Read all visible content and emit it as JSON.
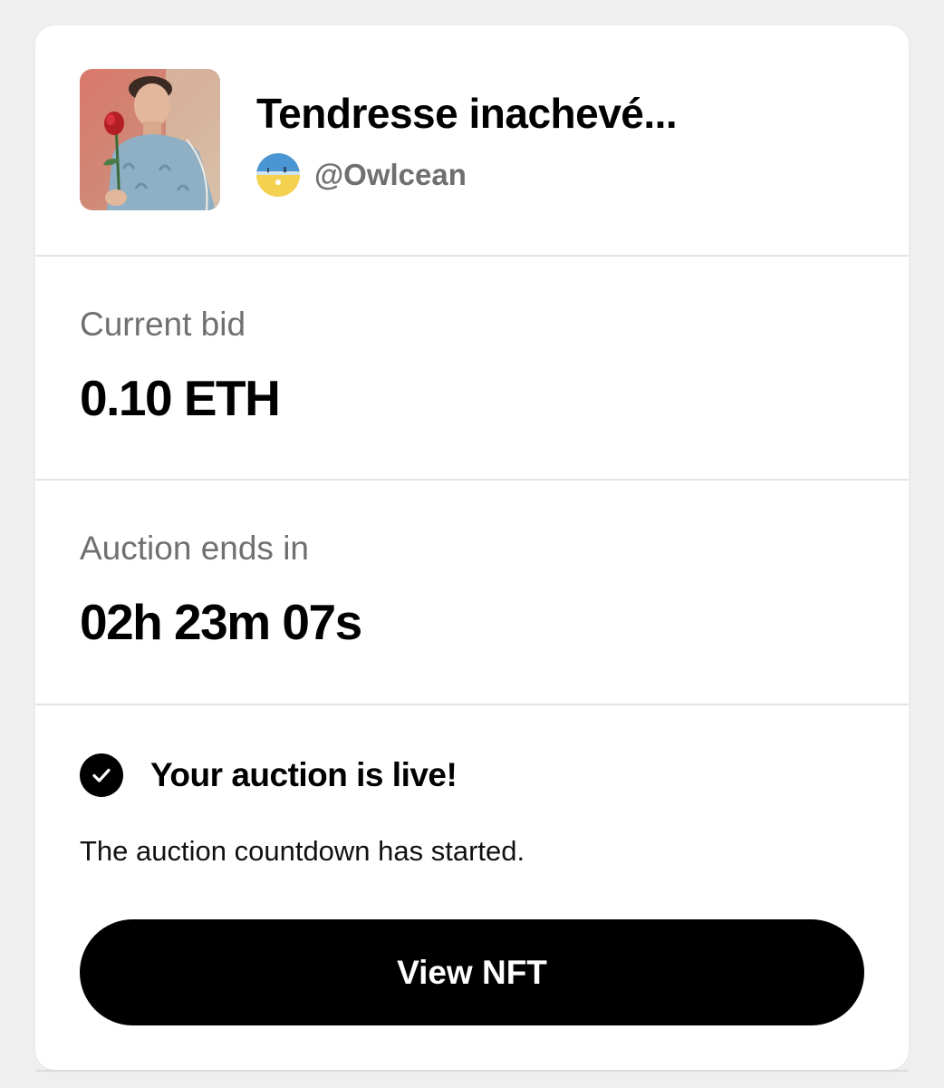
{
  "nft": {
    "title": "Tendresse inachevé...",
    "artwork_icon": "artwork-thumbnail",
    "creator_handle": "@Owlcean",
    "creator_avatar_icon": "creator-avatar"
  },
  "bid": {
    "label": "Current bid",
    "value": "0.10 ETH"
  },
  "auction": {
    "label": "Auction ends in",
    "countdown": "02h 23m 07s"
  },
  "status": {
    "icon": "check-circle-icon",
    "title": "Your auction is live!",
    "description": "The auction countdown has started."
  },
  "actions": {
    "view_label": "View NFT"
  },
  "colors": {
    "background": "#efefef",
    "card": "#ffffff",
    "button": "#000000",
    "button_text": "#ffffff",
    "muted_text": "#707070",
    "divider": "#e3e3e3"
  }
}
